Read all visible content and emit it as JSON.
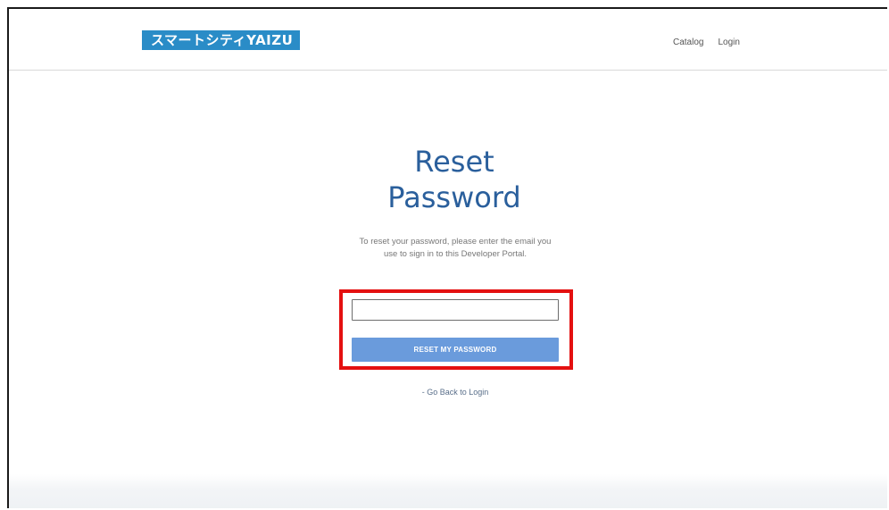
{
  "header": {
    "logo_text": "スマートシティYAIZU",
    "nav": [
      {
        "label": "Catalog"
      },
      {
        "label": "Login"
      }
    ]
  },
  "main": {
    "title_line1": "Reset",
    "title_line2": "Password",
    "description": "To reset your password, please enter the email you use to sign in to this Developer Portal.",
    "email_input": {
      "value": "",
      "placeholder": ""
    },
    "reset_button_label": "RESET MY PASSWORD",
    "back_link_label": "- Go Back to Login"
  },
  "colors": {
    "brand": "#2a8cc7",
    "title": "#2a5f9c",
    "button": "#6a9bdc",
    "highlight": "#e41010"
  }
}
